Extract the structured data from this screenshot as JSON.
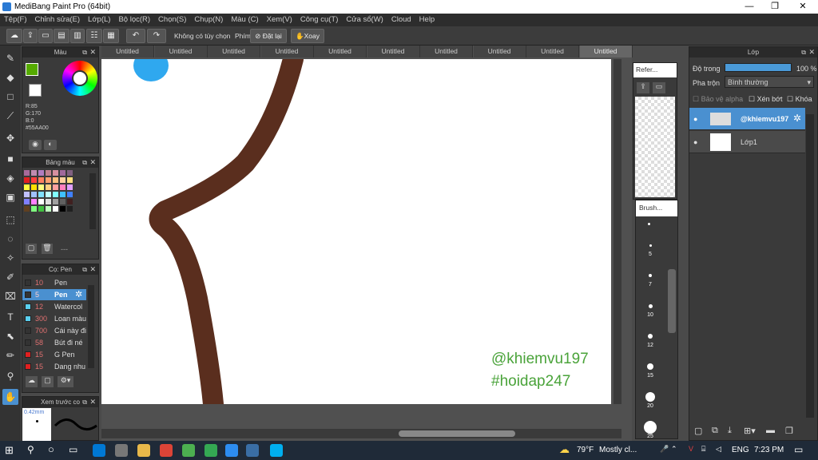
{
  "window": {
    "title": "MediBang Paint Pro (64bit)",
    "min_glyph": "—",
    "max_glyph": "❐",
    "close_glyph": "✕"
  },
  "menu": [
    "Tệp(F)",
    "Chỉnh sửa(E)",
    "Lớp(L)",
    "Bộ lọc(R)",
    "Chọn(S)",
    "Chụp(N)",
    "Màu (C)",
    "Xem(V)",
    "Công cụ(T)",
    "Cửa sổ(W)",
    "Cloud",
    "Help"
  ],
  "toolbar": {
    "no_selection": "Không có tùy chọn",
    "keys_label": "Phím",
    "reset_label": "Đặt lại",
    "rotate_label": "Xoay"
  },
  "color_panel": {
    "title": "Màu",
    "r": "R:85",
    "g": "G:170",
    "b": "B:0",
    "hex": "#55AA00",
    "primary_color": "#55AA00",
    "secondary_color": "#ffffff"
  },
  "palette_panel": {
    "title": "Bảng màu",
    "extra": "---",
    "colors": [
      "#a86a9a",
      "#c08bb0",
      "#b07cc0",
      "#c08090",
      "#d690a0",
      "#a0689c",
      "#806080",
      "#e02020",
      "#ff4040",
      "#ff8060",
      "#ffa070",
      "#ffc080",
      "#ffd0a0",
      "#ffe080",
      "#ffff40",
      "#ffe000",
      "#ffff80",
      "#ffd080",
      "#ffa0a0",
      "#ff80c0",
      "#e0a0ff",
      "#c0c0ff",
      "#a0c0ff",
      "#80e0ff",
      "#c0ffff",
      "#80ffff",
      "#40c0ff",
      "#4080ff",
      "#8080ff",
      "#ff80ff",
      "#ffffff",
      "#e0e0e0",
      "#a0a0a0",
      "#606060",
      "#402020",
      "#604020",
      "#80ff80",
      "#40c040",
      "#c0ffc0",
      "#ffffff",
      "#000000",
      "#202020"
    ]
  },
  "brush_panel": {
    "title": "Cọ: Pen",
    "items": [
      {
        "size": "10",
        "name": "Pen",
        "color": "#333333",
        "selected": false
      },
      {
        "size": "5",
        "name": "Pen",
        "color": "#333333",
        "selected": true
      },
      {
        "size": "12",
        "name": "Watercol",
        "color": "#5ad0f0",
        "selected": false
      },
      {
        "size": "300",
        "name": "Loan màu",
        "color": "#5ad0f0",
        "selected": false
      },
      {
        "size": "700",
        "name": "Cái này đi",
        "color": "#333333",
        "selected": false
      },
      {
        "size": "58",
        "name": "Bút đi né",
        "color": "#333333",
        "selected": false
      },
      {
        "size": "15",
        "name": "G Pen",
        "color": "#e02020",
        "selected": false
      },
      {
        "size": "15",
        "name": "Dang nhu",
        "color": "#e02020",
        "selected": false
      }
    ]
  },
  "preview_panel": {
    "title": "Xem trước co",
    "size": "0.42mm"
  },
  "tabs": [
    "Untitled",
    "Untitled",
    "Untitled",
    "Untitled",
    "Untitled",
    "Untitled",
    "Untitled",
    "Untitled",
    "Untitled",
    "Untitled"
  ],
  "watermark": {
    "line1": "@khiemvu197",
    "line2": "#hoidap247",
    "color": "#4aa33a"
  },
  "reference_panel": {
    "title": "Refer..."
  },
  "brush_size_panel": {
    "title": "Brush...",
    "sizes": [
      "5",
      "7",
      "10",
      "12",
      "15",
      "20",
      "25"
    ]
  },
  "layer_panel": {
    "title": "Lớp",
    "opacity_label": "Độ trong",
    "opacity_value": "100 %",
    "blend_label": "Pha trộn",
    "blend_value": "Bình thường",
    "protect_alpha": "Bảo vệ alpha",
    "clip": "Xén bớt",
    "lock": "Khóa",
    "layers": [
      {
        "name": "@khiemvu197",
        "selected": true
      },
      {
        "name": "Lớp1",
        "selected": false
      }
    ]
  },
  "taskbar": {
    "weather": "79°F",
    "weather_desc": "Mostly cl...",
    "lang": "ENG",
    "time": "7:23 PM"
  }
}
